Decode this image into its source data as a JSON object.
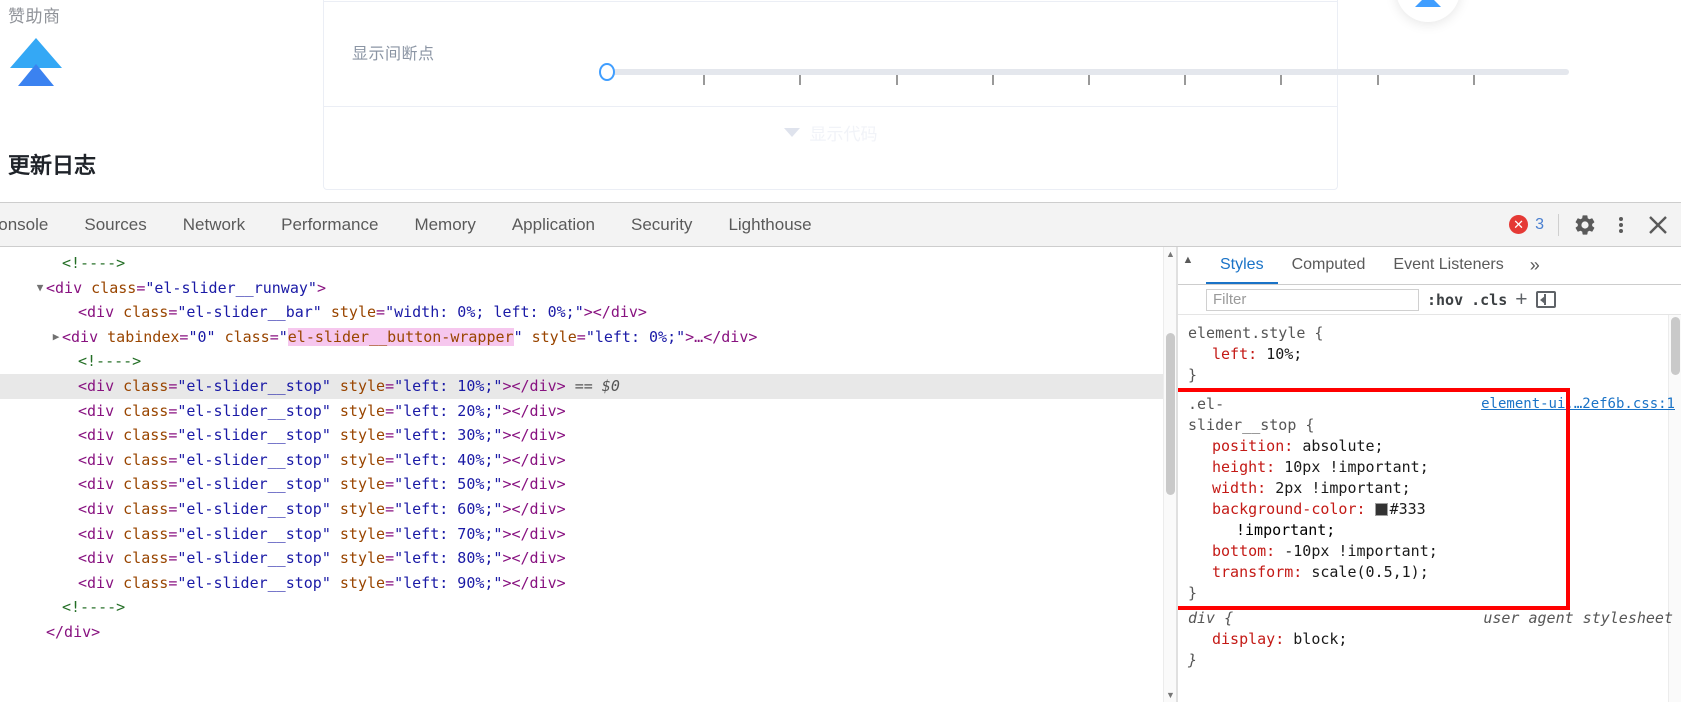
{
  "page": {
    "sponsor_label": "赞助商",
    "changelog_title": "更新日志",
    "demo": {
      "slider_label": "显示间断点",
      "slider_value": 0,
      "slider_stops": [
        10,
        20,
        30,
        40,
        50,
        60,
        70,
        80,
        90
      ],
      "show_code_label": "显示代码"
    }
  },
  "devtools": {
    "tabs": [
      {
        "label": "Console",
        "active": false
      },
      {
        "label": "Sources",
        "active": false
      },
      {
        "label": "Network",
        "active": false
      },
      {
        "label": "Performance",
        "active": false
      },
      {
        "label": "Memory",
        "active": false
      },
      {
        "label": "Application",
        "active": false
      },
      {
        "label": "Security",
        "active": false
      },
      {
        "label": "Lighthouse",
        "active": false
      }
    ],
    "error_count": "3",
    "dom_lines": [
      {
        "indent": 1,
        "twisty": "",
        "selected": false,
        "parts": [
          {
            "t": "comment",
            "s": "<!---->"
          }
        ]
      },
      {
        "indent": 0,
        "twisty": "▼",
        "selected": false,
        "parts": [
          {
            "t": "punct",
            "s": "<"
          },
          {
            "t": "tag",
            "s": "div"
          },
          {
            "t": "plain",
            "s": " "
          },
          {
            "t": "attr",
            "s": "class"
          },
          {
            "t": "punct",
            "s": "="
          },
          {
            "t": "val",
            "s": "\"el-slider__runway\""
          },
          {
            "t": "punct",
            "s": ">"
          }
        ]
      },
      {
        "indent": 2,
        "twisty": "",
        "selected": false,
        "parts": [
          {
            "t": "punct",
            "s": "<"
          },
          {
            "t": "tag",
            "s": "div"
          },
          {
            "t": "plain",
            "s": " "
          },
          {
            "t": "attr",
            "s": "class"
          },
          {
            "t": "punct",
            "s": "="
          },
          {
            "t": "val",
            "s": "\"el-slider__bar\""
          },
          {
            "t": "plain",
            "s": " "
          },
          {
            "t": "attr",
            "s": "style"
          },
          {
            "t": "punct",
            "s": "="
          },
          {
            "t": "val",
            "s": "\"width: 0%; left: 0%;\""
          },
          {
            "t": "punct",
            "s": "></div>"
          }
        ]
      },
      {
        "indent": 1,
        "twisty": "▶",
        "selected": false,
        "parts": [
          {
            "t": "punct",
            "s": "<"
          },
          {
            "t": "tag",
            "s": "div"
          },
          {
            "t": "plain",
            "s": " "
          },
          {
            "t": "attr",
            "s": "tabindex"
          },
          {
            "t": "punct",
            "s": "="
          },
          {
            "t": "val",
            "s": "\"0\""
          },
          {
            "t": "plain",
            "s": " "
          },
          {
            "t": "attr",
            "s": "class"
          },
          {
            "t": "punct",
            "s": "="
          },
          {
            "t": "val",
            "s": "\""
          },
          {
            "t": "hl",
            "s": "el-slider__button-wrapper"
          },
          {
            "t": "val",
            "s": "\""
          },
          {
            "t": "plain",
            "s": " "
          },
          {
            "t": "attr",
            "s": "style"
          },
          {
            "t": "punct",
            "s": "="
          },
          {
            "t": "val",
            "s": "\"left: 0%;\""
          },
          {
            "t": "punct",
            "s": ">…</div>"
          }
        ]
      },
      {
        "indent": 2,
        "twisty": "",
        "selected": false,
        "parts": [
          {
            "t": "comment",
            "s": "<!---->"
          }
        ]
      },
      {
        "indent": 2,
        "twisty": "",
        "selected": true,
        "parts": [
          {
            "t": "punct",
            "s": "<"
          },
          {
            "t": "tag",
            "s": "div"
          },
          {
            "t": "plain",
            "s": " "
          },
          {
            "t": "attr",
            "s": "class"
          },
          {
            "t": "punct",
            "s": "="
          },
          {
            "t": "val",
            "s": "\"el-slider__stop\""
          },
          {
            "t": "plain",
            "s": " "
          },
          {
            "t": "attr",
            "s": "style"
          },
          {
            "t": "punct",
            "s": "="
          },
          {
            "t": "val",
            "s": "\"left: 10%;\""
          },
          {
            "t": "punct",
            "s": "></div>"
          },
          {
            "t": "sel0",
            "s": " == $0"
          }
        ]
      },
      {
        "indent": 2,
        "twisty": "",
        "selected": false,
        "parts": [
          {
            "t": "punct",
            "s": "<"
          },
          {
            "t": "tag",
            "s": "div"
          },
          {
            "t": "plain",
            "s": " "
          },
          {
            "t": "attr",
            "s": "class"
          },
          {
            "t": "punct",
            "s": "="
          },
          {
            "t": "val",
            "s": "\"el-slider__stop\""
          },
          {
            "t": "plain",
            "s": " "
          },
          {
            "t": "attr",
            "s": "style"
          },
          {
            "t": "punct",
            "s": "="
          },
          {
            "t": "val",
            "s": "\"left: 20%;\""
          },
          {
            "t": "punct",
            "s": "></div>"
          }
        ]
      },
      {
        "indent": 2,
        "twisty": "",
        "selected": false,
        "parts": [
          {
            "t": "punct",
            "s": "<"
          },
          {
            "t": "tag",
            "s": "div"
          },
          {
            "t": "plain",
            "s": " "
          },
          {
            "t": "attr",
            "s": "class"
          },
          {
            "t": "punct",
            "s": "="
          },
          {
            "t": "val",
            "s": "\"el-slider__stop\""
          },
          {
            "t": "plain",
            "s": " "
          },
          {
            "t": "attr",
            "s": "style"
          },
          {
            "t": "punct",
            "s": "="
          },
          {
            "t": "val",
            "s": "\"left: 30%;\""
          },
          {
            "t": "punct",
            "s": "></div>"
          }
        ]
      },
      {
        "indent": 2,
        "twisty": "",
        "selected": false,
        "parts": [
          {
            "t": "punct",
            "s": "<"
          },
          {
            "t": "tag",
            "s": "div"
          },
          {
            "t": "plain",
            "s": " "
          },
          {
            "t": "attr",
            "s": "class"
          },
          {
            "t": "punct",
            "s": "="
          },
          {
            "t": "val",
            "s": "\"el-slider__stop\""
          },
          {
            "t": "plain",
            "s": " "
          },
          {
            "t": "attr",
            "s": "style"
          },
          {
            "t": "punct",
            "s": "="
          },
          {
            "t": "val",
            "s": "\"left: 40%;\""
          },
          {
            "t": "punct",
            "s": "></div>"
          }
        ]
      },
      {
        "indent": 2,
        "twisty": "",
        "selected": false,
        "parts": [
          {
            "t": "punct",
            "s": "<"
          },
          {
            "t": "tag",
            "s": "div"
          },
          {
            "t": "plain",
            "s": " "
          },
          {
            "t": "attr",
            "s": "class"
          },
          {
            "t": "punct",
            "s": "="
          },
          {
            "t": "val",
            "s": "\"el-slider__stop\""
          },
          {
            "t": "plain",
            "s": " "
          },
          {
            "t": "attr",
            "s": "style"
          },
          {
            "t": "punct",
            "s": "="
          },
          {
            "t": "val",
            "s": "\"left: 50%;\""
          },
          {
            "t": "punct",
            "s": "></div>"
          }
        ]
      },
      {
        "indent": 2,
        "twisty": "",
        "selected": false,
        "parts": [
          {
            "t": "punct",
            "s": "<"
          },
          {
            "t": "tag",
            "s": "div"
          },
          {
            "t": "plain",
            "s": " "
          },
          {
            "t": "attr",
            "s": "class"
          },
          {
            "t": "punct",
            "s": "="
          },
          {
            "t": "val",
            "s": "\"el-slider__stop\""
          },
          {
            "t": "plain",
            "s": " "
          },
          {
            "t": "attr",
            "s": "style"
          },
          {
            "t": "punct",
            "s": "="
          },
          {
            "t": "val",
            "s": "\"left: 60%;\""
          },
          {
            "t": "punct",
            "s": "></div>"
          }
        ]
      },
      {
        "indent": 2,
        "twisty": "",
        "selected": false,
        "parts": [
          {
            "t": "punct",
            "s": "<"
          },
          {
            "t": "tag",
            "s": "div"
          },
          {
            "t": "plain",
            "s": " "
          },
          {
            "t": "attr",
            "s": "class"
          },
          {
            "t": "punct",
            "s": "="
          },
          {
            "t": "val",
            "s": "\"el-slider__stop\""
          },
          {
            "t": "plain",
            "s": " "
          },
          {
            "t": "attr",
            "s": "style"
          },
          {
            "t": "punct",
            "s": "="
          },
          {
            "t": "val",
            "s": "\"left: 70%;\""
          },
          {
            "t": "punct",
            "s": "></div>"
          }
        ]
      },
      {
        "indent": 2,
        "twisty": "",
        "selected": false,
        "parts": [
          {
            "t": "punct",
            "s": "<"
          },
          {
            "t": "tag",
            "s": "div"
          },
          {
            "t": "plain",
            "s": " "
          },
          {
            "t": "attr",
            "s": "class"
          },
          {
            "t": "punct",
            "s": "="
          },
          {
            "t": "val",
            "s": "\"el-slider__stop\""
          },
          {
            "t": "plain",
            "s": " "
          },
          {
            "t": "attr",
            "s": "style"
          },
          {
            "t": "punct",
            "s": "="
          },
          {
            "t": "val",
            "s": "\"left: 80%;\""
          },
          {
            "t": "punct",
            "s": "></div>"
          }
        ]
      },
      {
        "indent": 2,
        "twisty": "",
        "selected": false,
        "parts": [
          {
            "t": "punct",
            "s": "<"
          },
          {
            "t": "tag",
            "s": "div"
          },
          {
            "t": "plain",
            "s": " "
          },
          {
            "t": "attr",
            "s": "class"
          },
          {
            "t": "punct",
            "s": "="
          },
          {
            "t": "val",
            "s": "\"el-slider__stop\""
          },
          {
            "t": "plain",
            "s": " "
          },
          {
            "t": "attr",
            "s": "style"
          },
          {
            "t": "punct",
            "s": "="
          },
          {
            "t": "val",
            "s": "\"left: 90%;\""
          },
          {
            "t": "punct",
            "s": "></div>"
          }
        ]
      },
      {
        "indent": 1,
        "twisty": "",
        "selected": false,
        "parts": [
          {
            "t": "comment",
            "s": "<!---->"
          }
        ]
      },
      {
        "indent": 0,
        "twisty": "",
        "selected": false,
        "parts": [
          {
            "t": "punct",
            "s": "</div>"
          }
        ]
      }
    ],
    "styles": {
      "tabs": [
        {
          "label": "Styles",
          "active": true
        },
        {
          "label": "Computed",
          "active": false
        },
        {
          "label": "Event Listeners",
          "active": false
        }
      ],
      "more_label": "»",
      "filter_placeholder": "Filter",
      "filter_value": "",
      "hov_label": ":hov",
      "cls_label": ".cls",
      "plus_label": "+",
      "rules": [
        {
          "selector": "element.style",
          "source": "",
          "wrapped": false,
          "highlighted": false,
          "declarations": [
            {
              "prop": "left",
              "value": "10%",
              "important": false,
              "swatch": ""
            }
          ]
        },
        {
          "selector": ".el-slider__stop",
          "selector_line1": ".el-",
          "selector_line2": "slider__stop",
          "source": "element-ui.…2ef6b.css:1",
          "wrapped": true,
          "highlighted": true,
          "declarations": [
            {
              "prop": "position",
              "value": "absolute",
              "important": false,
              "swatch": ""
            },
            {
              "prop": "height",
              "value": "10px !important",
              "important": true,
              "swatch": ""
            },
            {
              "prop": "width",
              "value": "2px !important",
              "important": true,
              "swatch": ""
            },
            {
              "prop": "background-color",
              "value": "#333",
              "important": true,
              "important_wrapped": "!important",
              "swatch": "#333333"
            },
            {
              "prop": "bottom",
              "value": "-10px !important",
              "important": true,
              "swatch": ""
            },
            {
              "prop": "transform",
              "value": "scale(0.5,1)",
              "important": false,
              "swatch": ""
            }
          ]
        },
        {
          "selector": "div",
          "source": "",
          "ua": true,
          "ua_note": "user agent stylesheet",
          "declarations": [
            {
              "prop": "display",
              "value": "block",
              "important": false,
              "swatch": ""
            }
          ]
        }
      ]
    }
  },
  "colors": {
    "accent": "#409eff",
    "devtools_tab_active": "#1a73c7",
    "error_red": "#e53935",
    "css_prop": "#c41a16",
    "dom_attr": "#994500",
    "dom_value": "#1a1aa6",
    "dom_tag": "#881280",
    "highlight_box": "#ff0000"
  }
}
